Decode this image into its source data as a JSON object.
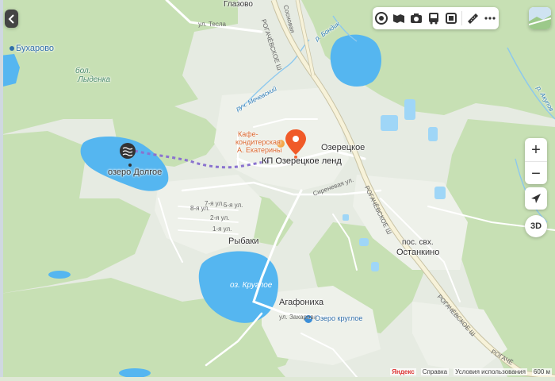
{
  "map": {
    "places": {
      "buharovo": "Бухарово",
      "glazovo": "Глазово",
      "ozeretskoe": "Озерецкое",
      "rybaki": "Рыбаки",
      "agafonikha": "Агафониха",
      "ostankino_1": "пос. свх.",
      "ostankino_2": "Останкино"
    },
    "water": {
      "dolgoe": "озеро Долгое",
      "krugloe": "оз. Круглое",
      "lydenka_1": "бол.",
      "lydenka_2": "Лыденка",
      "mechevsky": "руч. Мечевский",
      "bondyk": "р. Бондик",
      "akulov": "р. Акулов"
    },
    "roads": {
      "rogachevskoe_1": "РОГАЧЁВСКОЕ Ш",
      "rogachevskoe_2": "РОГАЧЁВСКОЕ Ш",
      "rogachevskoe_3": "РОГАЧЁВСКОЕ Ш",
      "rogachevskoe_4": "РОГАЧЁ",
      "sosnovaya": "Сосновая",
      "teslya": "ул. Тесла",
      "sirenevaya": "Сиреневая ул.",
      "zakharova": "ул. Захарова",
      "s8": "8-я ул.",
      "s7": "7-я ул.",
      "s5": "5-я ул.",
      "s2": "2-я ул.",
      "s1": "1-я ул."
    },
    "poi": {
      "cafe_line1": "Кафе-",
      "cafe_line2": "кондитерская",
      "cafe_line3": "А. Екатерины",
      "kp": "КП Озерецкое ленд",
      "ozero_krugloe": "Озеро круглое"
    },
    "controls": {
      "back_icon": "chevron-left-icon",
      "layers_icon": "layers-icon",
      "panorama_icon": "panorama-icon",
      "camera_icon": "camera-icon",
      "bus_icon": "bus-icon",
      "traffic_icon": "traffic-icon",
      "ruler_icon": "ruler-icon",
      "more_icon": "more-icon",
      "zoom_in": "+",
      "zoom_out": "−",
      "locate_icon": "location-arrow-icon",
      "mode_3d": "3D"
    },
    "footer": {
      "brand": "Яндекс",
      "help": "Справка",
      "terms": "Условия использования",
      "scale": "600 м",
      "copy": "© Яндекс"
    },
    "colors": {
      "forest": "#c7e0b4",
      "open": "#e6ebe2",
      "water": "#55b6f0",
      "road": "#ffffff",
      "highway": "#f7f2d9",
      "route": "#8a72cf",
      "pin": "#f05a28"
    }
  }
}
